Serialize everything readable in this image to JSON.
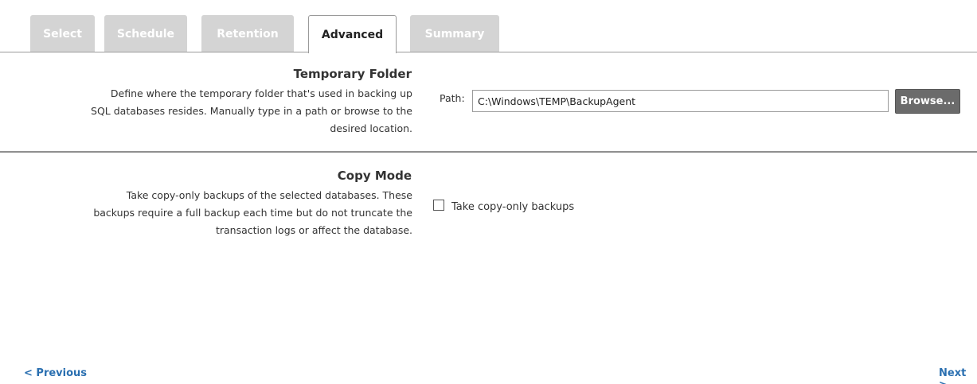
{
  "tabs": [
    {
      "label": "Select",
      "active": false
    },
    {
      "label": "Schedule",
      "active": false
    },
    {
      "label": "Retention",
      "active": false
    },
    {
      "label": "Advanced",
      "active": true
    },
    {
      "label": "Summary",
      "active": false
    }
  ],
  "temporary_folder": {
    "title": "Temporary Folder",
    "description_lines": [
      "Define where the temporary folder that's used in backing up",
      "SQL databases resides. Manually type in a path or browse to the",
      "desired location."
    ],
    "path_label": "Path:",
    "path_value": "C:\\Windows\\TEMP\\BackupAgent",
    "browse_label": "Browse..."
  },
  "copy_mode": {
    "title": "Copy Mode",
    "description_lines": [
      "Take copy-only backups of the selected databases. These",
      "backups require a full backup each time but do not truncate the",
      "transaction logs or affect the database."
    ],
    "checkbox_label": "Take copy-only backups",
    "checked": false
  },
  "nav": {
    "previous_label": "< Previous",
    "next_label": "Next >"
  },
  "colors": {
    "link": "#2a6fb0",
    "tab_inactive": "#d4d4d4",
    "button": "#6b6b6b"
  }
}
